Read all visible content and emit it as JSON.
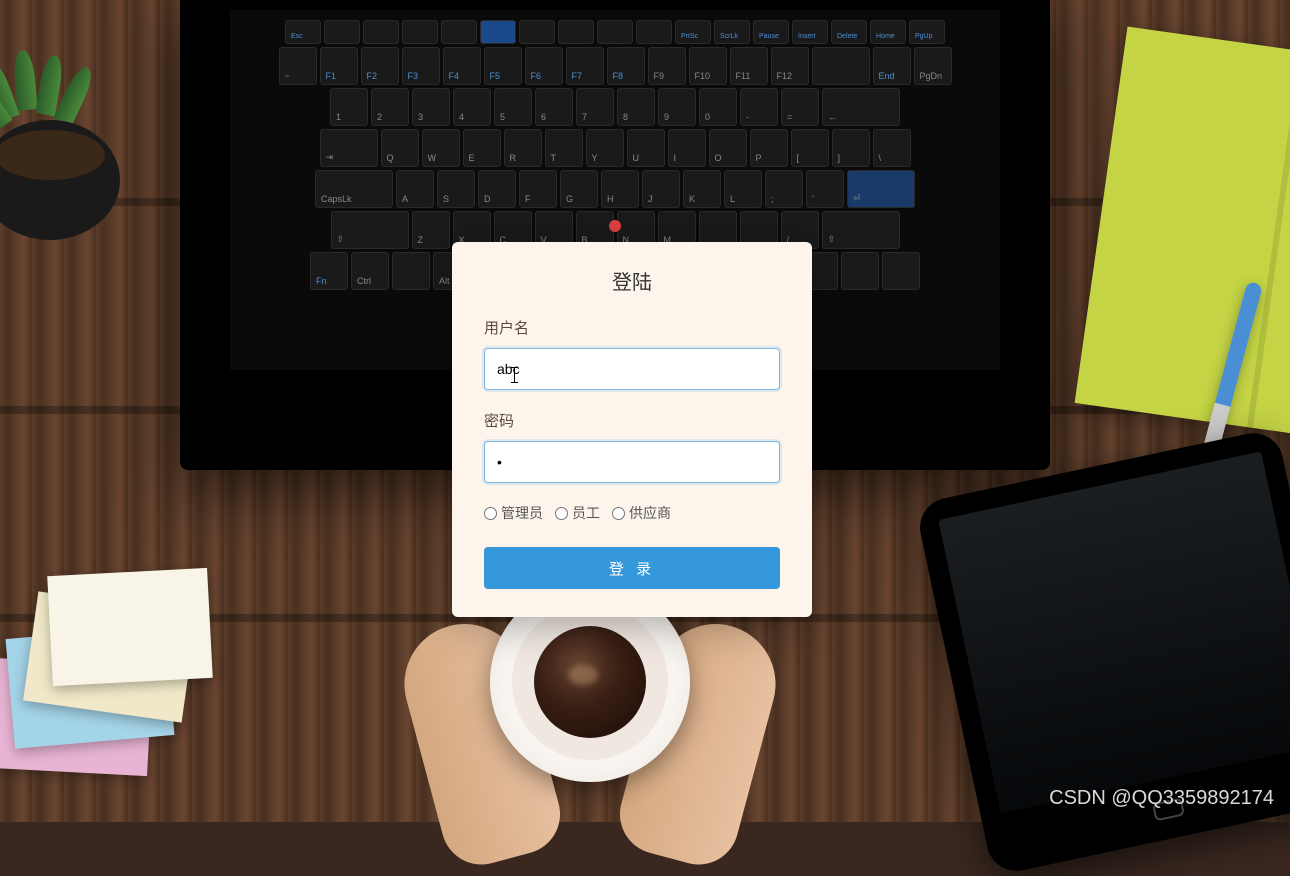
{
  "login": {
    "title": "登陆",
    "username_label": "用户名",
    "username_value": "abc",
    "password_label": "密码",
    "password_value": "•",
    "roles": {
      "admin": "管理员",
      "employee": "员工",
      "supplier": "供应商"
    },
    "submit_label": "登 录"
  },
  "watermark": "CSDN @QQ3359892174"
}
